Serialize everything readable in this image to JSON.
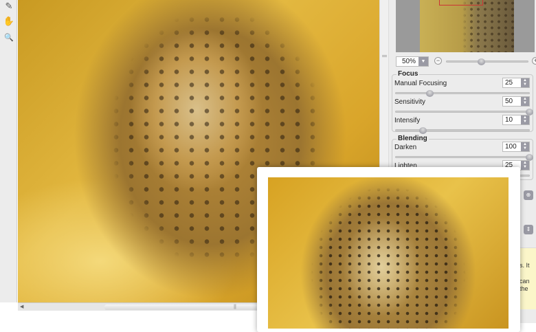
{
  "toolbar": {
    "tools": [
      {
        "name": "eraser-icon",
        "glyph": "✎"
      },
      {
        "name": "hand-icon",
        "glyph": "✋"
      },
      {
        "name": "zoom-icon",
        "glyph": "🔍"
      }
    ]
  },
  "canvas": {
    "scroll_grip": "||"
  },
  "navigator": {
    "zoom_value": "50%",
    "zoom_minus": "−",
    "zoom_plus": "+",
    "zoom_slider_fraction": 0.42
  },
  "focus": {
    "title": "Focus",
    "params": [
      {
        "label": "Manual Focusing",
        "value": "25",
        "fraction": 0.25
      },
      {
        "label": "Sensitivity",
        "value": "50",
        "fraction": 1.0
      },
      {
        "label": "Intensify",
        "value": "10",
        "fraction": 0.2
      }
    ]
  },
  "blending": {
    "title": "Blending",
    "params": [
      {
        "label": "Darken",
        "value": "100",
        "fraction": 1.0
      },
      {
        "label": "Lighten",
        "value": "25",
        "fraction": 0.25
      }
    ]
  },
  "help": {
    "lines": [
      "s. It",
      "can",
      "the"
    ]
  }
}
